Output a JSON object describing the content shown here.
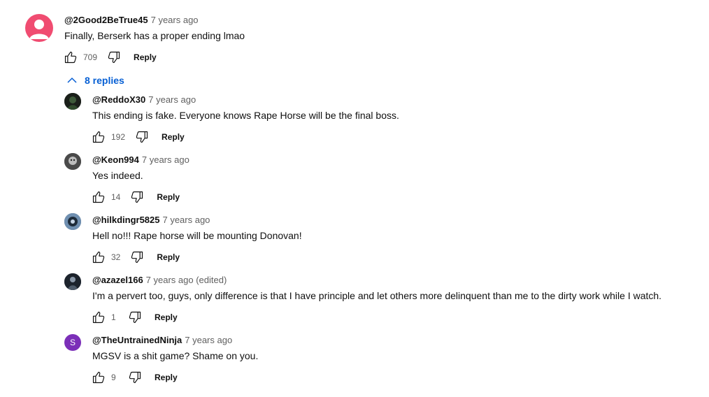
{
  "top_comment": {
    "author": "@2Good2BeTrue45",
    "time": "7 years ago",
    "text": "Finally, Berserk has a proper  ending lmao",
    "likes": "709",
    "reply_label": "Reply",
    "avatar_color": "#f04c71"
  },
  "replies_toggle": {
    "label": "8 replies",
    "icon": "chevron-up-icon"
  },
  "replies": [
    {
      "author": "@ReddoX30",
      "time": "7 years ago",
      "text": "This ending is fake. Everyone knows Rape Horse will be the final boss.",
      "likes": "192",
      "reply_label": "Reply",
      "avatar_color": "#1f2a1f"
    },
    {
      "author": "@Keon994",
      "time": "7 years ago",
      "text": "Yes indeed.",
      "likes": "14",
      "reply_label": "Reply",
      "avatar_color": "#5a5a5a"
    },
    {
      "author": "@hilkdingr5825",
      "time": "7 years ago",
      "text": "Hell no!!! Rape horse will be mounting Donovan!",
      "likes": "32",
      "reply_label": "Reply",
      "avatar_color": "#3d5a7a"
    },
    {
      "author": "@azazel166",
      "time": "7 years ago (edited)",
      "text": "I'm a pervert too, guys, only difference is that I have principle and let others more delinquent than me to the dirty work while I watch.",
      "likes": "1",
      "reply_label": "Reply",
      "avatar_color": "#2a3340"
    },
    {
      "author": "@TheUntrainedNinja",
      "time": "7 years ago",
      "text": "MGSV is a shit game? Shame on you.",
      "likes": "9",
      "reply_label": "Reply",
      "avatar_color": "#7b2fb8",
      "avatar_letter": "S"
    }
  ]
}
